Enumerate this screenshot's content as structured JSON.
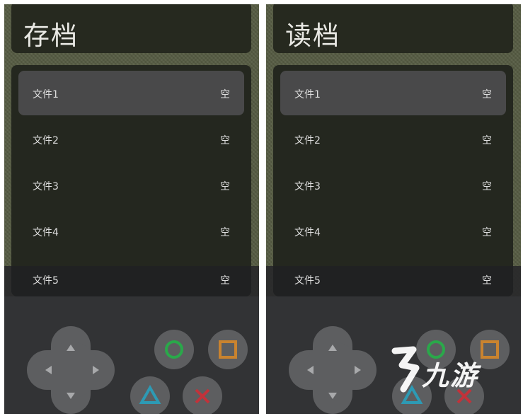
{
  "left_screen": {
    "title": "存档",
    "slots": [
      {
        "name": "文件1",
        "status": "空",
        "selected": true
      },
      {
        "name": "文件2",
        "status": "空"
      },
      {
        "name": "文件3",
        "status": "空"
      },
      {
        "name": "文件4",
        "status": "空"
      },
      {
        "name": "文件5",
        "status": "空"
      }
    ]
  },
  "right_screen": {
    "title": "读档",
    "slots": [
      {
        "name": "文件1",
        "status": "空",
        "selected": true
      },
      {
        "name": "文件2",
        "status": "空"
      },
      {
        "name": "文件3",
        "status": "空"
      },
      {
        "name": "文件4",
        "status": "空"
      },
      {
        "name": "文件5",
        "status": "空"
      }
    ]
  },
  "controls": {
    "dpad_icons": [
      "up-arrow-icon",
      "down-arrow-icon",
      "left-arrow-icon",
      "right-arrow-icon"
    ],
    "face_buttons": [
      {
        "icon": "circle-icon",
        "color": "#2aa84a"
      },
      {
        "icon": "square-icon",
        "color": "#c9832f"
      },
      {
        "icon": "triangle-icon",
        "color": "#2d9ab4"
      },
      {
        "icon": "cross-icon",
        "color": "#c2323a"
      }
    ]
  },
  "watermark": {
    "text": "九游",
    "icon": "9game-logo-icon"
  }
}
